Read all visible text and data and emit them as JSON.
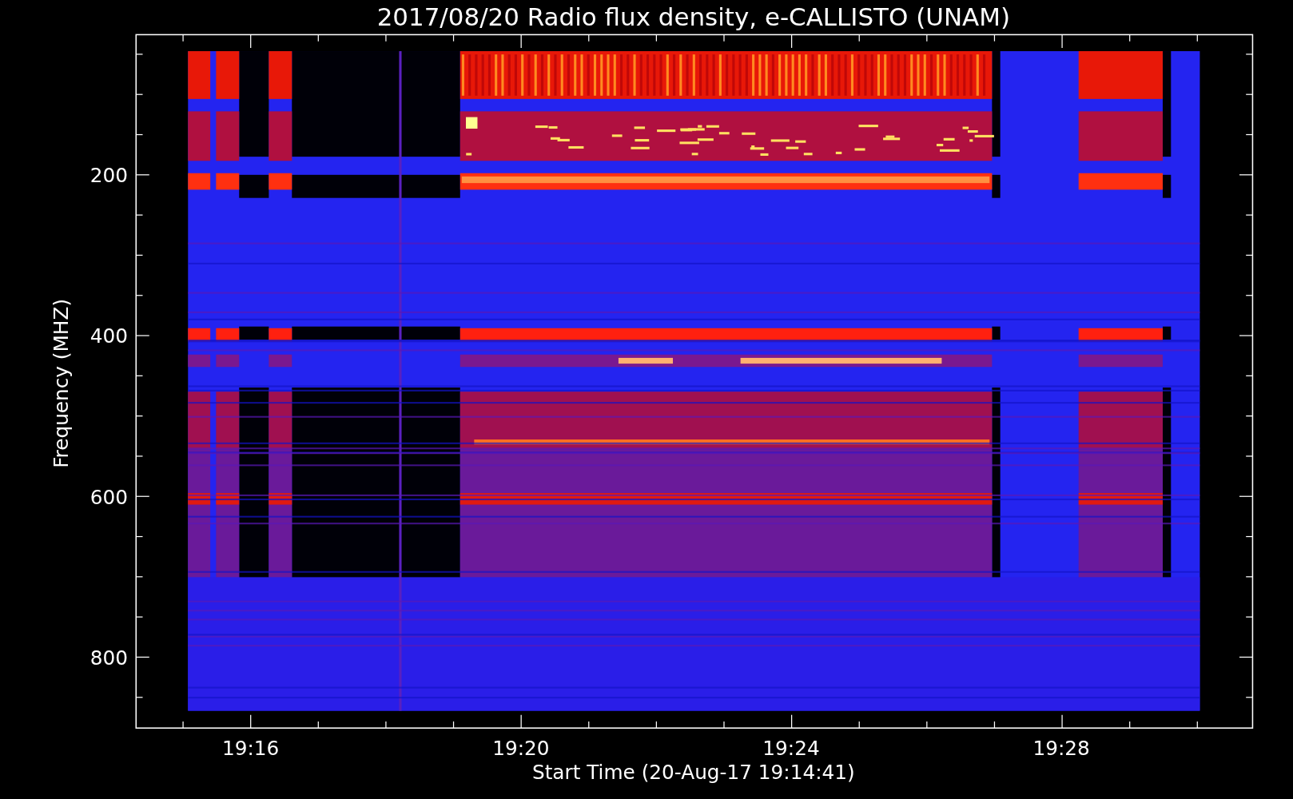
{
  "title": "2017/08/20  Radio flux density, e-CALLISTO (UNAM)",
  "y_axis": {
    "label": "Frequency (MHZ)",
    "ticks": [
      "200",
      "400",
      "600",
      "800"
    ]
  },
  "x_axis": {
    "label": "Start Time (20-Aug-17 19:14:41)",
    "ticks": [
      "19:16",
      "19:20",
      "19:24",
      "19:28"
    ]
  }
}
